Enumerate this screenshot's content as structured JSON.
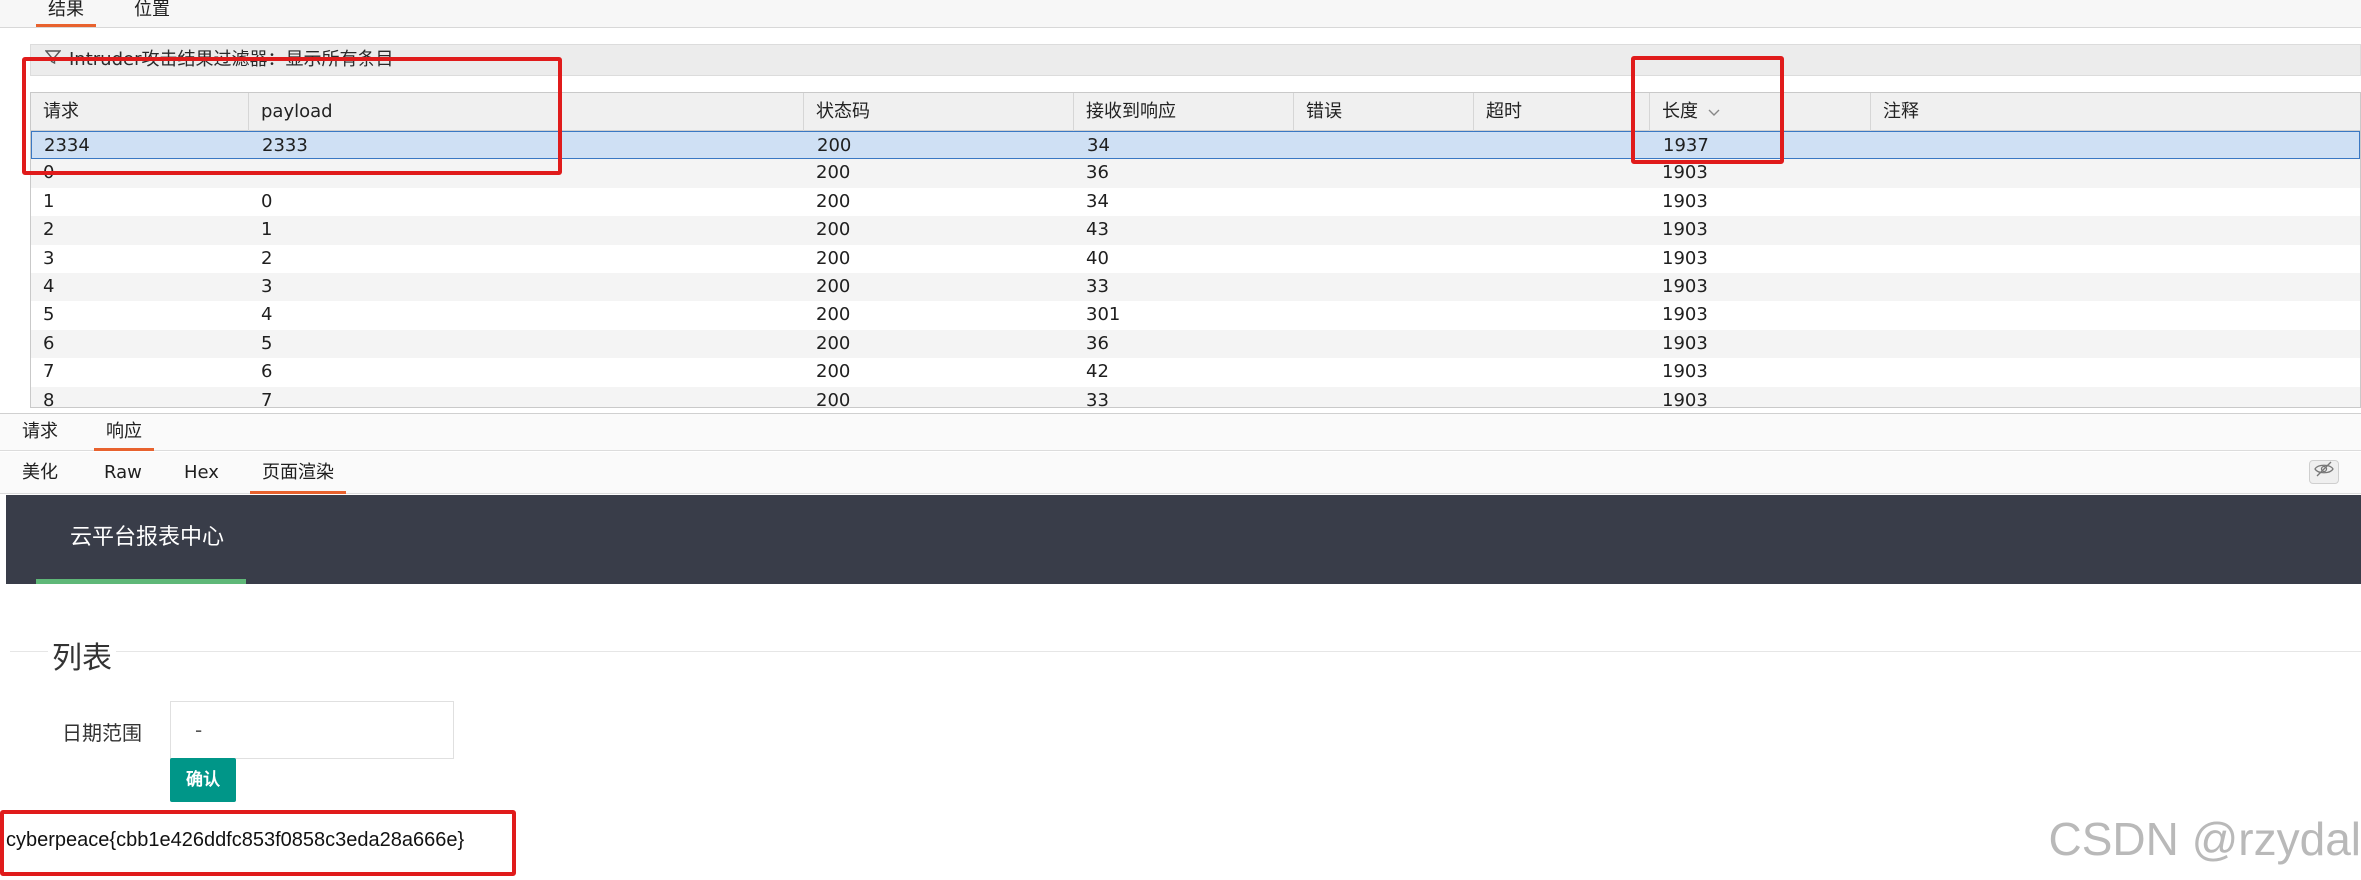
{
  "top_tabs": [
    "结果",
    "位置"
  ],
  "filter": {
    "label": "Intruder攻击结果过滤器：显示所有条目"
  },
  "table": {
    "columns": [
      "请求",
      "payload",
      "状态码",
      "接收到响应",
      "错误",
      "超时",
      "长度",
      "注释"
    ],
    "sort_column": "长度",
    "rows": [
      [
        "2334",
        "2333",
        "200",
        "34",
        "",
        "",
        "1937",
        ""
      ],
      [
        "0",
        "",
        "200",
        "36",
        "",
        "",
        "1903",
        ""
      ],
      [
        "1",
        "0",
        "200",
        "34",
        "",
        "",
        "1903",
        ""
      ],
      [
        "2",
        "1",
        "200",
        "43",
        "",
        "",
        "1903",
        ""
      ],
      [
        "3",
        "2",
        "200",
        "40",
        "",
        "",
        "1903",
        ""
      ],
      [
        "4",
        "3",
        "200",
        "33",
        "",
        "",
        "1903",
        ""
      ],
      [
        "5",
        "4",
        "200",
        "301",
        "",
        "",
        "1903",
        ""
      ],
      [
        "6",
        "5",
        "200",
        "36",
        "",
        "",
        "1903",
        ""
      ],
      [
        "7",
        "6",
        "200",
        "42",
        "",
        "",
        "1903",
        ""
      ],
      [
        "8",
        "7",
        "200",
        "33",
        "",
        "",
        "1903",
        ""
      ]
    ]
  },
  "lower_tabs": [
    "请求",
    "响应"
  ],
  "sub_tabs": [
    "美化",
    "Raw",
    "Hex",
    "页面渲染"
  ],
  "rendered": {
    "brand": "云平台报表中心",
    "legend": "列表",
    "date_label": "日期范围",
    "date_value": "-",
    "confirm": "确认",
    "flag": "cyberpeace{cbb1e426ddfc853f0858c3eda28a666e}"
  },
  "watermark": "CSDN @rzydal",
  "colors": {
    "accent": "#e8622e",
    "highlight": "#e01b1b",
    "header_dark": "#393d49",
    "brand_green": "#5fb878",
    "button_teal": "#009688",
    "selected_row": "#cfe0f4"
  }
}
